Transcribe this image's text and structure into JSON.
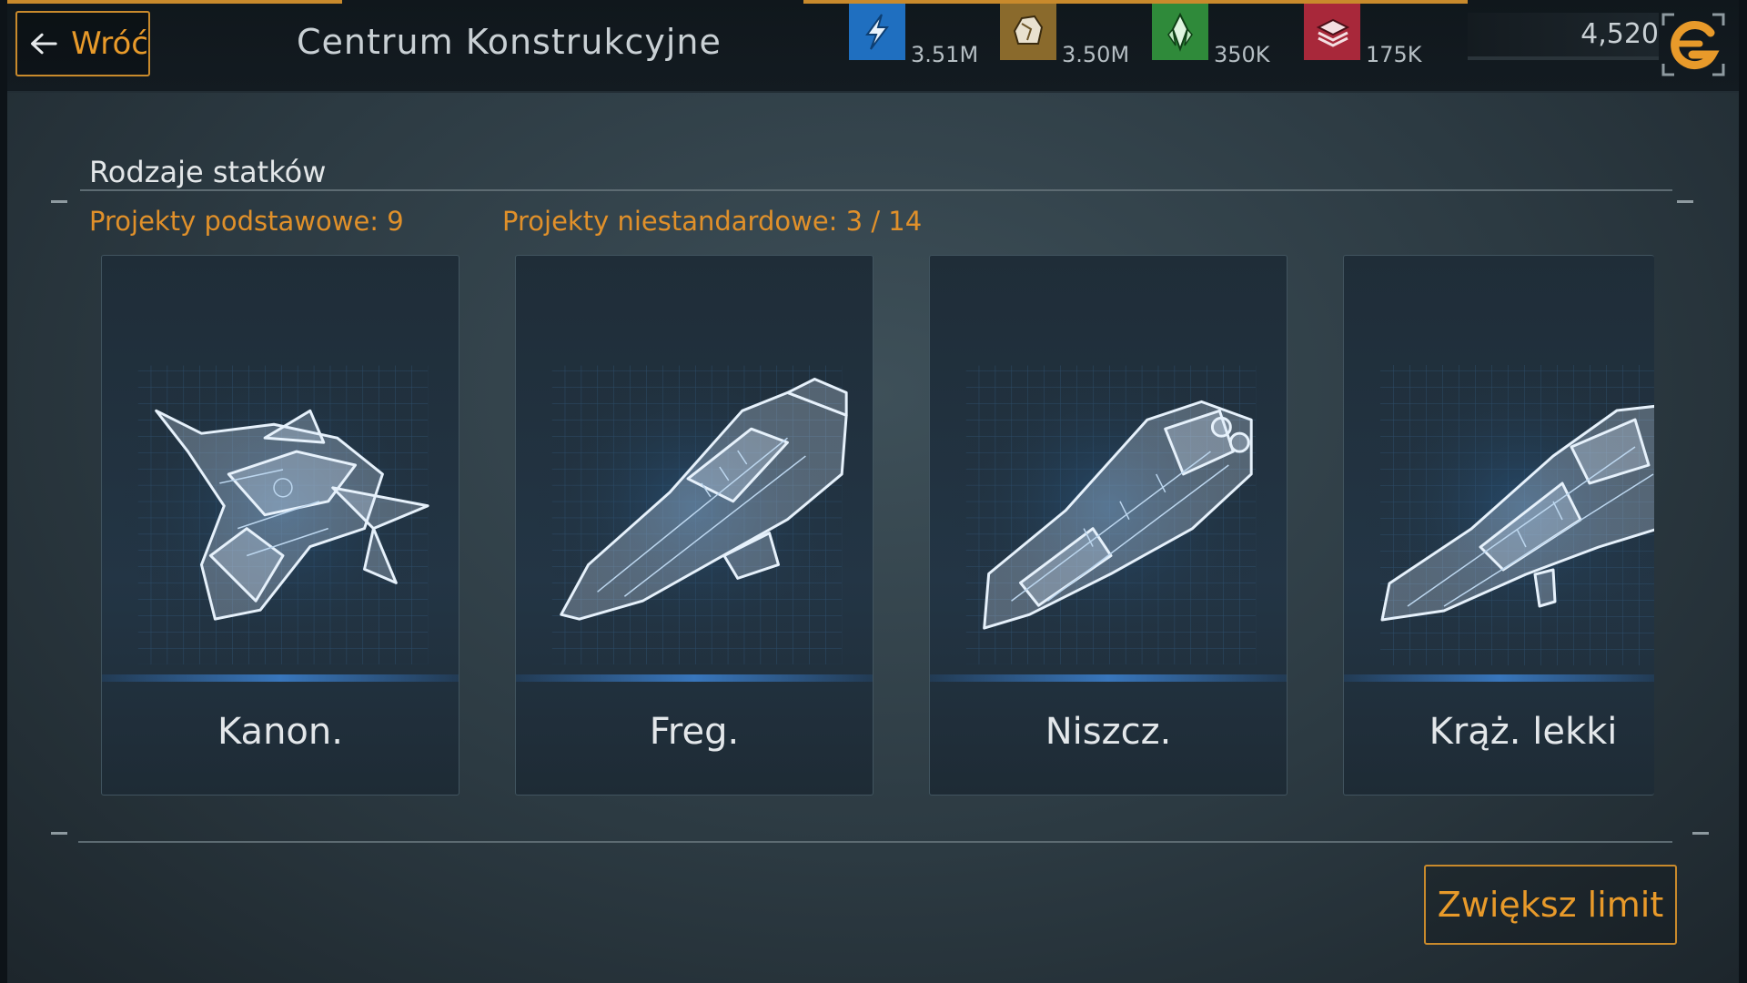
{
  "header": {
    "back_label": "Wróć",
    "title": "Centrum Konstrukcyjne",
    "resources": [
      {
        "name": "energy",
        "icon": "lightning-icon",
        "value": "3.51M",
        "color": "#1f6fc0"
      },
      {
        "name": "ore",
        "icon": "ore-icon",
        "value": "3.50M",
        "color": "#8a6a2c"
      },
      {
        "name": "crystal",
        "icon": "crystal-icon",
        "value": "350K",
        "color": "#2f8a3a"
      },
      {
        "name": "modules",
        "icon": "modules-icon",
        "value": "175K",
        "color": "#a8283a"
      }
    ],
    "currency": {
      "value": "4,520",
      "icon": "currency-icon"
    }
  },
  "section": {
    "title": "Rodzaje statków",
    "basic_projects": "Projekty podstawowe: 9",
    "custom_projects": "Projekty niestandardowe: 3 / 14"
  },
  "ships": [
    {
      "label": "Kanon.",
      "icon": "gunship-blueprint-icon"
    },
    {
      "label": "Freg.",
      "icon": "frigate-blueprint-icon"
    },
    {
      "label": "Niszcz.",
      "icon": "destroyer-blueprint-icon"
    },
    {
      "label": "Krąż. lekki",
      "icon": "light-cruiser-blueprint-icon"
    }
  ],
  "footer": {
    "increase_limit_label": "Zwiększ limit"
  },
  "colors": {
    "accent": "#e89a2a",
    "accent_border": "#c98a2c",
    "card_glow": "#3c82d2"
  }
}
